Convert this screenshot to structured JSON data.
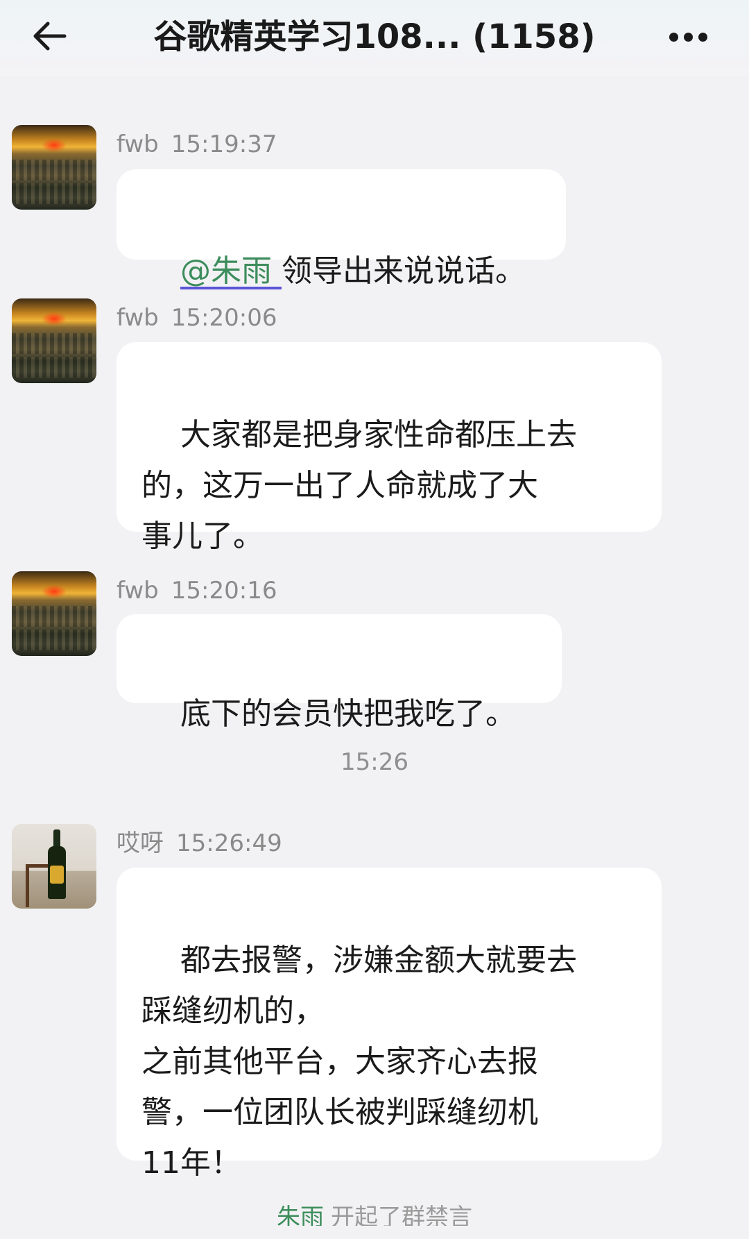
{
  "header": {
    "title": "谷歌精英学习108... (1158)",
    "back_icon": "arrow-left-icon",
    "more_icon": "more-horizontal-icon"
  },
  "messages": [
    {
      "sender": "fwb",
      "time": "15:19:37",
      "mention": "@朱雨 ",
      "text": "领导出来说说话。",
      "avatar": "sunset-landscape-avatar"
    },
    {
      "sender": "fwb",
      "time": "15:20:06",
      "text": "大家都是把身家性命都压上去\n的，这万一出了人命就成了大\n事儿了。",
      "avatar": "sunset-landscape-avatar"
    },
    {
      "sender": "fwb",
      "time": "15:20:16",
      "text": "底下的会员快把我吃了。",
      "avatar": "sunset-landscape-avatar"
    },
    {
      "sender": "哎呀",
      "time": "15:26:49",
      "text": "都去报警，涉嫌金额大就要去\n踩缝纫机的，\n之前其他平台，大家齐心去报\n警，一位团队长被判踩缝纫机\n11年！",
      "avatar": "beer-bottle-avatar"
    }
  ],
  "time_separator": "15:26",
  "system_notice": {
    "who": "朱雨",
    "text": "开起了群禁言"
  },
  "colors": {
    "mention": "#3d8d5c",
    "bubble": "#ffffff",
    "background": "#f2f2f4"
  }
}
